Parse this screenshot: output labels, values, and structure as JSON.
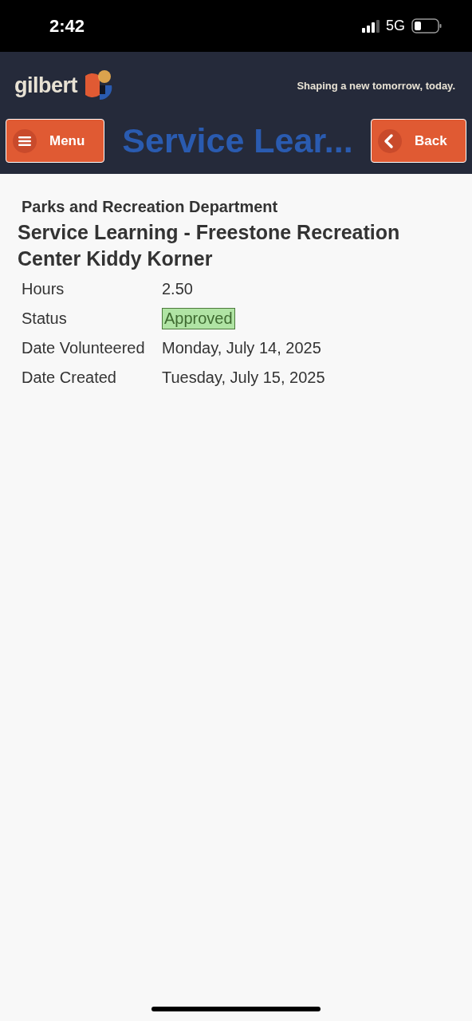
{
  "status_bar": {
    "time": "2:42",
    "network": "5G"
  },
  "header": {
    "logo": "gilbert",
    "tagline": "Shaping a new tomorrow, today.",
    "menu_button": "Menu",
    "title": "Service Lear...",
    "back_button": "Back"
  },
  "department": "Parks and Recreation Department",
  "activity": "Service Learning - Freestone Recreation Center Kiddy Korner",
  "details": [
    {
      "label": "Hours",
      "value": "2.50",
      "kind": "text"
    },
    {
      "label": "Status",
      "value": "Approved",
      "kind": "badge"
    },
    {
      "label": "Date Volunteered",
      "value": "Monday, July 14, 2025",
      "kind": "text"
    },
    {
      "label": "Date Created",
      "value": "Tuesday, July 15, 2025",
      "kind": "text"
    }
  ]
}
